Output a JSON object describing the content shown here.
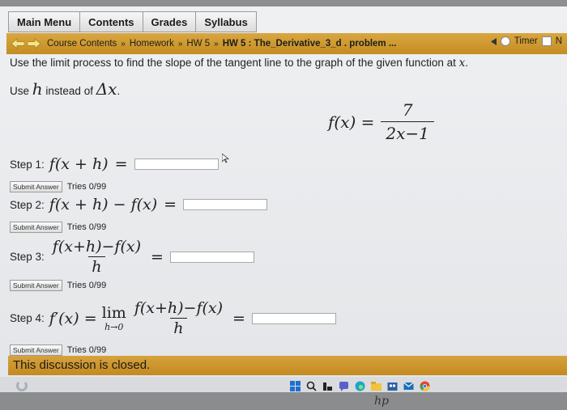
{
  "menu": {
    "items": [
      "Main Menu",
      "Contents",
      "Grades",
      "Syllabus"
    ]
  },
  "breadcrumb": {
    "course_contents": "Course Contents",
    "homework": "Homework",
    "hw5": "HW 5",
    "current": "HW 5 : The_Derivative_3_d . problem ...",
    "timer_label": "Timer",
    "right_glyph": "N"
  },
  "problem": {
    "instruction_text": "Use the limit process to find the slope of the tangent line to the graph of the given function at ",
    "instruction_var": "x",
    "instruction_end": ".",
    "use_prefix": "Use ",
    "use_h": "h",
    "use_mid": " instead of ",
    "use_delta": "Δx",
    "use_end": ".",
    "function_lhs": "f(x) =",
    "function_num": "7",
    "function_den": "2x−1"
  },
  "steps": [
    {
      "label": "Step 1:",
      "expr": "f(x + h)",
      "submit": "Submit Answer",
      "tries": "Tries 0/99"
    },
    {
      "label": "Step 2:",
      "expr": "f(x + h) − f(x)",
      "submit": "Submit Answer",
      "tries": "Tries 0/99"
    },
    {
      "label": "Step 3:",
      "num": "f(x+h)−f(x)",
      "den": "h",
      "submit": "Submit Answer",
      "tries": "Tries 0/99"
    },
    {
      "label": "Step 4:",
      "lhs": "f′(x) =",
      "lim": "lim",
      "lim_sub": "h→0",
      "num": "f(x+h)−f(x)",
      "den": "h",
      "submit": "Submit Answer",
      "tries": "Tries 0/99"
    }
  ],
  "equals": "=",
  "closed_message": "This discussion is closed.",
  "brand": "hp",
  "colors": {
    "accent_gold": "#c48d22",
    "page_bg": "#e6e8eb"
  }
}
